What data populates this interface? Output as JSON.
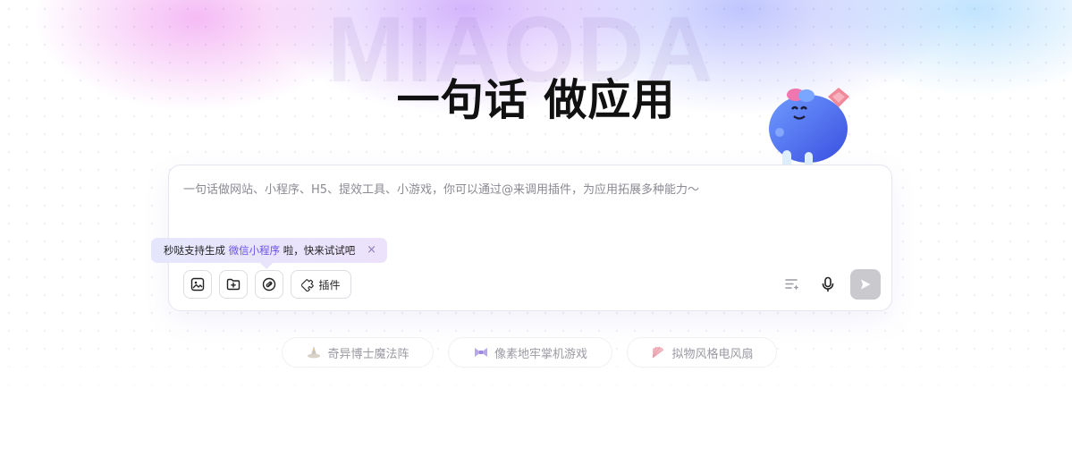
{
  "hero": {
    "watermark": "MIAODA",
    "title": "一句话 做应用"
  },
  "composer": {
    "placeholder": "一句话做网站、小程序、H5、提效工具、小游戏，你可以通过@来调用插件，为应用拓展多种能力～",
    "tooltip": {
      "prefix": "秒哒支持生成 ",
      "highlight": "微信小程序",
      "suffix": " 啦，快来试试吧",
      "close": "×"
    },
    "toolbar": {
      "plugin_label": "插件",
      "icons": [
        "image-upload-icon",
        "folder-upload-icon",
        "link-icon",
        "plugin-icon",
        "prompt-optimize-icon",
        "microphone-icon",
        "send-icon"
      ]
    }
  },
  "suggestions": [
    {
      "label": "奇异博士魔法阵",
      "icon": "magic-hat-icon"
    },
    {
      "label": "像素地牢掌机游戏",
      "icon": "pixel-bow-icon"
    },
    {
      "label": "拟物风格电风扇",
      "icon": "fan-icon"
    }
  ],
  "colors": {
    "accent": "#6b50e8",
    "send_disabled": "#c9c9ce"
  }
}
